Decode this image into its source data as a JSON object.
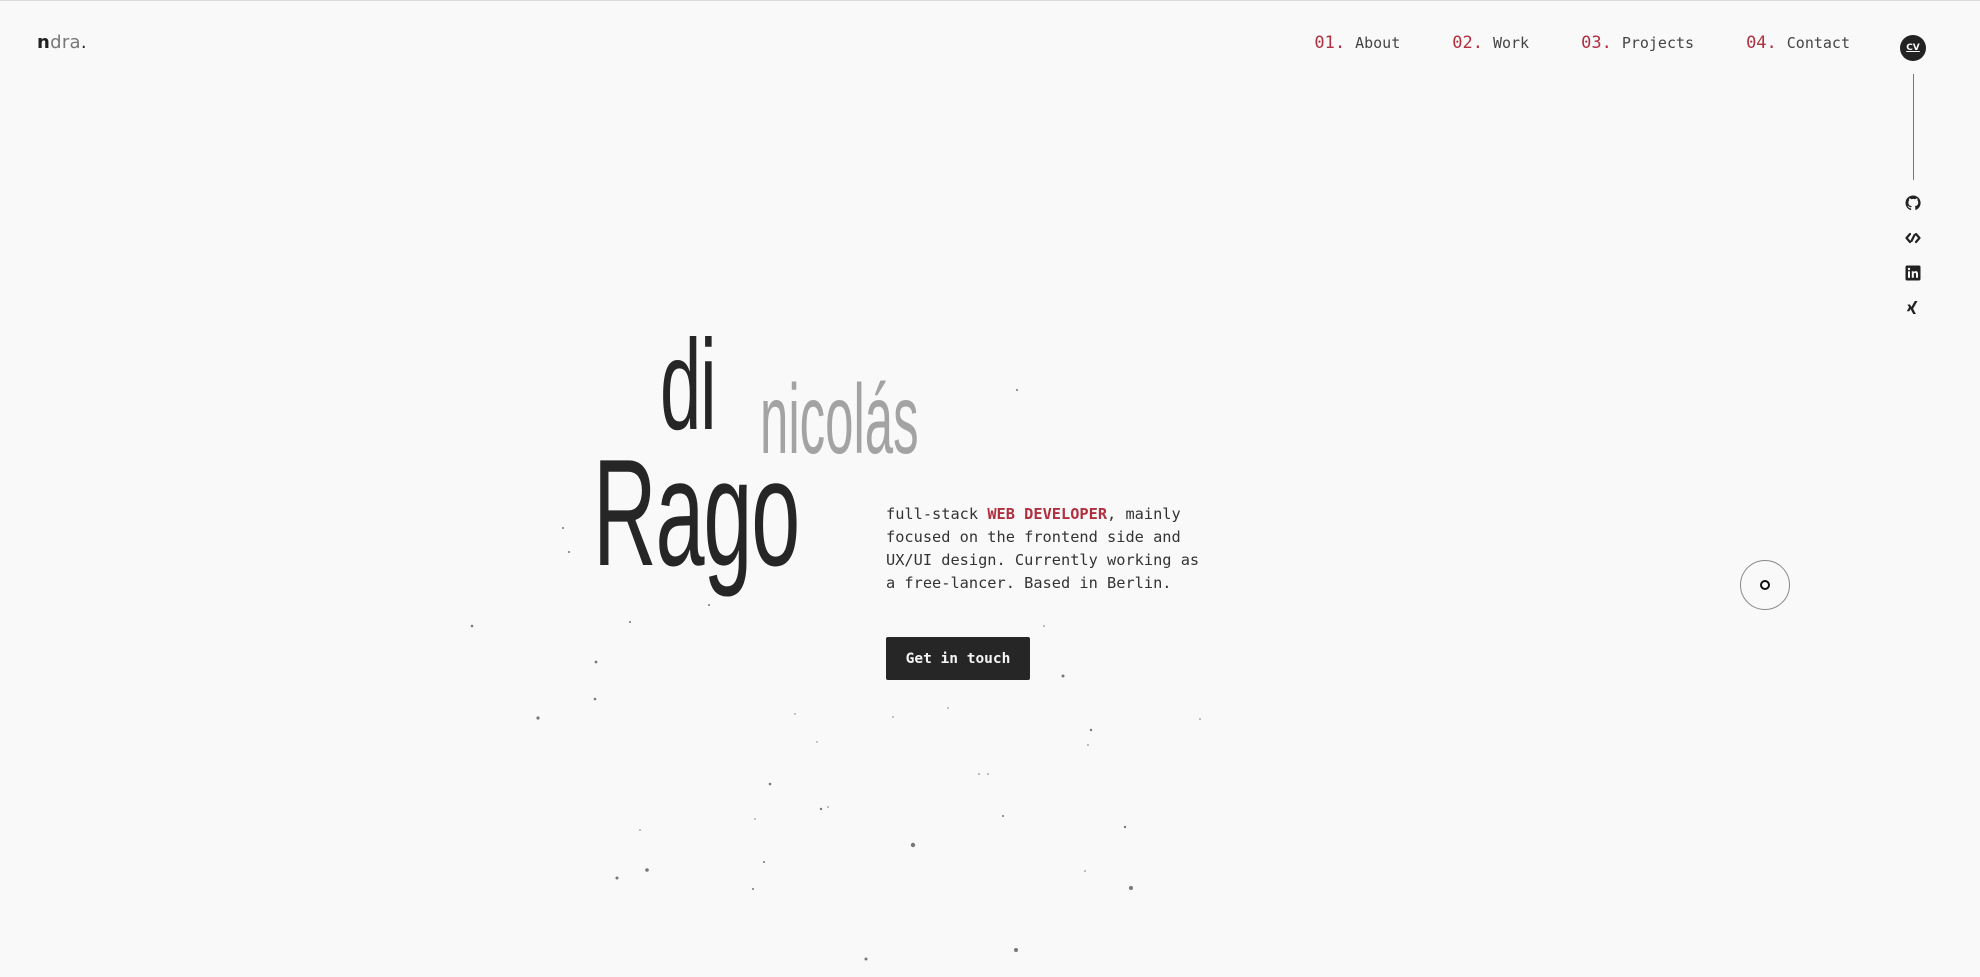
{
  "logo": {
    "first": "n",
    "rest": "dra",
    "dot": "."
  },
  "nav": [
    {
      "num": "01.",
      "label": "About"
    },
    {
      "num": "02.",
      "label": "Work"
    },
    {
      "num": "03.",
      "label": "Projects"
    },
    {
      "num": "04.",
      "label": "Contact"
    }
  ],
  "rail": {
    "cv_label": "CV",
    "icons": [
      "github-icon",
      "codepen-icon",
      "linkedin-icon",
      "xing-icon"
    ]
  },
  "hero": {
    "name_di": "di",
    "name_nicolas": "nicolás",
    "name_rago": "Rago",
    "intro_before": "full-stack ",
    "intro_highlight": "WEB DEVELOPER",
    "intro_after": ", mainly focused on the frontend side and UX/UI design. Currently working as a free-lancer. Based in Berlin.",
    "cta_label": "Get in touch"
  },
  "colors": {
    "accent": "#b03040",
    "dark": "#262626",
    "muted": "#a3a3a3",
    "background": "#f9f9f9"
  }
}
